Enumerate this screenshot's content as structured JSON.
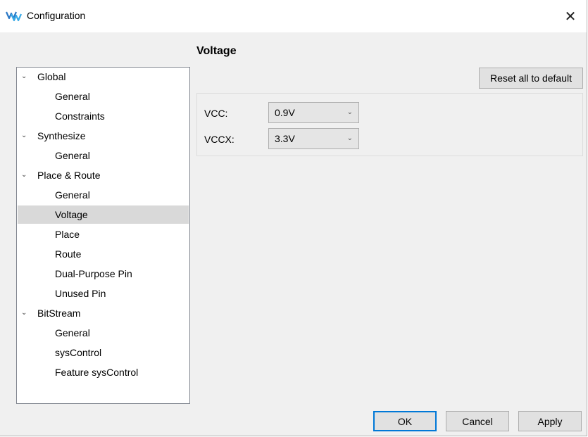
{
  "window": {
    "title": "Configuration",
    "close_glyph": "✕",
    "app_icon": "app-logo-icon"
  },
  "tree": {
    "items": [
      {
        "label": "Global",
        "level": 0,
        "expanded": true
      },
      {
        "label": "General",
        "level": 1
      },
      {
        "label": "Constraints",
        "level": 1
      },
      {
        "label": "Synthesize",
        "level": 0,
        "expanded": true
      },
      {
        "label": "General",
        "level": 1
      },
      {
        "label": "Place & Route",
        "level": 0,
        "expanded": true
      },
      {
        "label": "General",
        "level": 1
      },
      {
        "label": "Voltage",
        "level": 1,
        "selected": true
      },
      {
        "label": "Place",
        "level": 1
      },
      {
        "label": "Route",
        "level": 1
      },
      {
        "label": "Dual-Purpose Pin",
        "level": 1
      },
      {
        "label": "Unused Pin",
        "level": 1
      },
      {
        "label": "BitStream",
        "level": 0,
        "expanded": true
      },
      {
        "label": "General",
        "level": 1
      },
      {
        "label": "sysControl",
        "level": 1
      },
      {
        "label": "Feature sysControl",
        "level": 1
      }
    ],
    "expand_glyph": "⌄"
  },
  "page": {
    "title": "Voltage",
    "reset_label": "Reset all to default"
  },
  "fields": {
    "vcc": {
      "label": "VCC:",
      "value": "0.9V"
    },
    "vccx": {
      "label": "VCCX:",
      "value": "3.3V"
    },
    "dropdown_glyph": "⌄"
  },
  "buttons": {
    "ok": "OK",
    "cancel": "Cancel",
    "apply": "Apply"
  },
  "colors": {
    "selection": "#d9d9d9",
    "focus_border": "#0078d7",
    "dialog_bg": "#f0f0f0"
  }
}
